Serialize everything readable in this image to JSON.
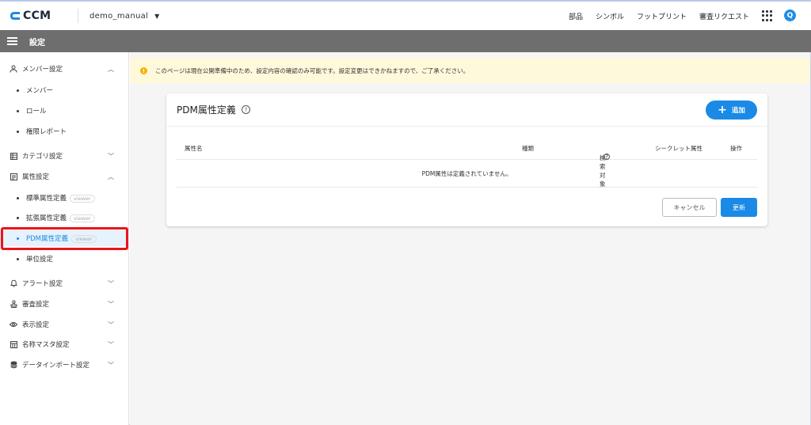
{
  "app": {
    "logo_text": "CCM",
    "workspace": "demo_manual"
  },
  "top_nav": {
    "parts": "部品",
    "symbols": "シンボル",
    "footprints": "フットプリント",
    "review_request": "審査リクエスト",
    "user_initial": "Q"
  },
  "title_bar": {
    "title": "設定"
  },
  "sidebar": {
    "member_settings": "メンバー設定",
    "member": "メンバー",
    "role": "ロール",
    "permission_report": "権限レポート",
    "category_settings": "カテゴリ設定",
    "attribute_settings": "属性設定",
    "standard_attr": "標準属性定義",
    "extended_attr": "拡張属性定義",
    "pdm_attr": "PDM属性定義",
    "viewer_badge": "viewer",
    "unit_settings": "単位設定",
    "alert_settings": "アラート設定",
    "review_settings": "審査設定",
    "display_settings": "表示設定",
    "name_master_settings": "名称マスタ設定",
    "data_import_settings": "データインポート設定"
  },
  "notice": {
    "text": "このページは現在公開準備中のため、設定内容の確認のみ可能です。設定変更はできかねますので、ご了承ください。"
  },
  "card": {
    "title": "PDM属性定義",
    "add_label": "追加",
    "columns": {
      "attr_name": "属性名",
      "type": "種類",
      "search_target": "検索対象",
      "secret_attr": "シークレット属性",
      "actions": "操作"
    },
    "empty_message": "PDM属性は定義されていません。",
    "cancel_label": "キャンセル",
    "update_label": "更新"
  },
  "colors": {
    "accent": "#1a8ae6",
    "title_bar": "#6e6e6e",
    "notice_bg": "#fff9dc",
    "highlight": "#e8141d"
  }
}
